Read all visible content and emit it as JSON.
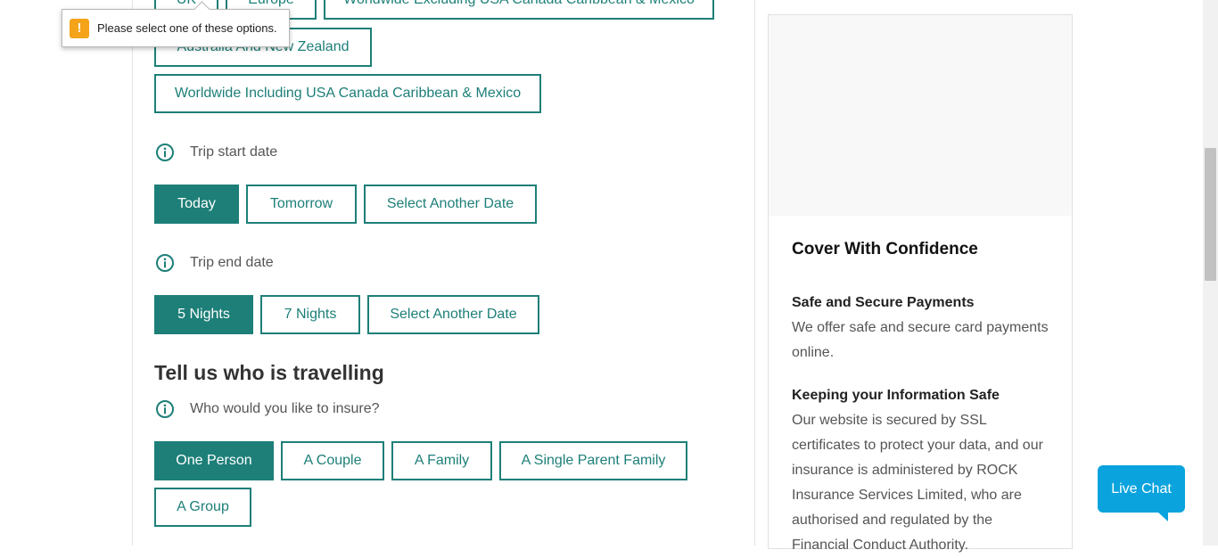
{
  "region": {
    "options": [
      {
        "label": "UK"
      },
      {
        "label": "Europe"
      },
      {
        "label": "Worldwide Excluding USA Canada Caribbean & Mexico"
      },
      {
        "label": "Australia And New Zealand"
      },
      {
        "label": "Worldwide Including USA Canada Caribbean & Mexico"
      }
    ],
    "validation_message": "Please select one of these options."
  },
  "trip_start": {
    "label": "Trip start date",
    "options": [
      {
        "label": "Today",
        "selected": true
      },
      {
        "label": "Tomorrow",
        "selected": false
      },
      {
        "label": "Select Another Date",
        "selected": false
      }
    ]
  },
  "trip_end": {
    "label": "Trip end date",
    "options": [
      {
        "label": "5 Nights",
        "selected": true
      },
      {
        "label": "7 Nights",
        "selected": false
      },
      {
        "label": "Select Another Date",
        "selected": false
      }
    ]
  },
  "travellers": {
    "title": "Tell us who is travelling",
    "question": "Who would you like to insure?",
    "options": [
      {
        "label": "One Person",
        "selected": true
      },
      {
        "label": "A Couple",
        "selected": false
      },
      {
        "label": "A Family",
        "selected": false
      },
      {
        "label": "A Single Parent Family",
        "selected": false
      },
      {
        "label": "A Group",
        "selected": false
      }
    ]
  },
  "sidebar": {
    "title": "Cover With Confidence",
    "sections": [
      {
        "heading": "Safe and Secure Payments",
        "lines": [
          "We offer safe and secure card payments",
          "online."
        ]
      },
      {
        "heading": "Keeping your Information Safe",
        "lines": [
          "Our website is secured by SSL",
          "certificates to protect your data, and our",
          "insurance is administered by ROCK",
          "Insurance Services Limited, who are",
          "authorised and regulated by the",
          "Financial Conduct Authority."
        ]
      }
    ]
  },
  "chat": {
    "label": "Live Chat"
  },
  "colors": {
    "primary": "#1d7f78",
    "chat": "#0aa3dd",
    "warning": "#f5a318"
  }
}
